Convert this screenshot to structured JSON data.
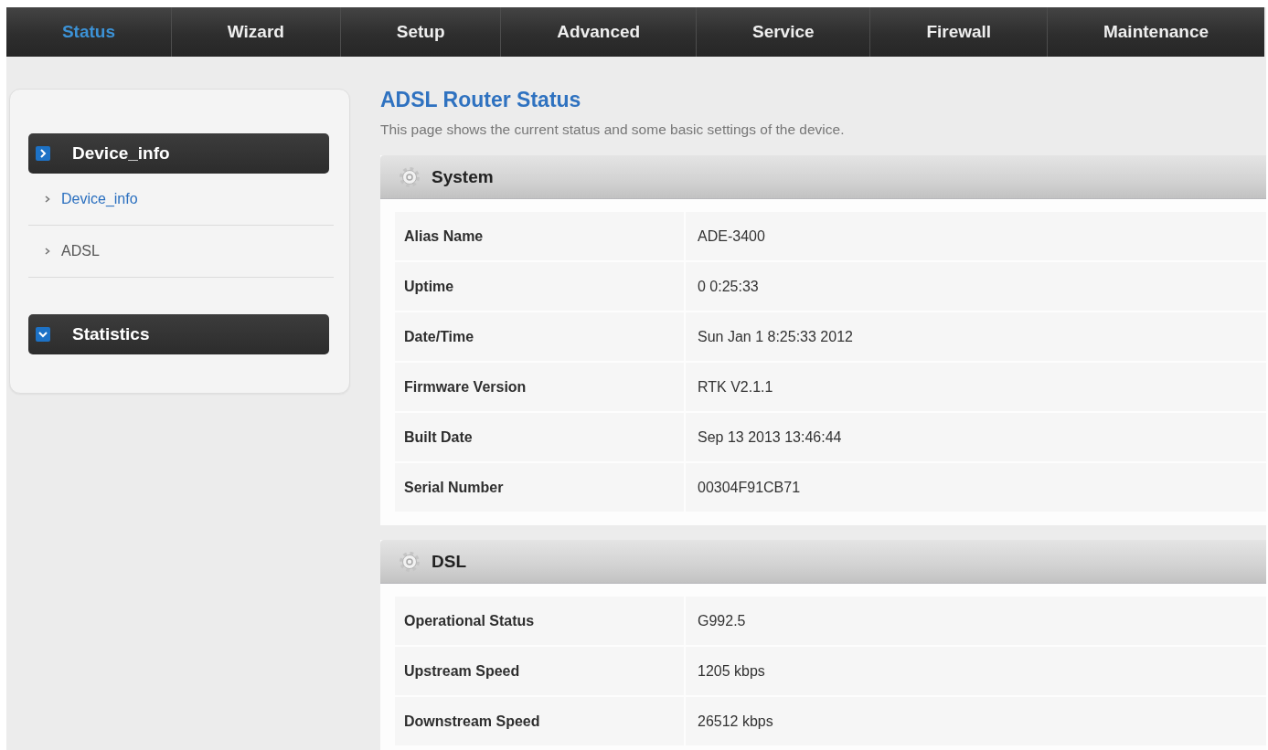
{
  "nav": [
    {
      "label": "Status",
      "selected": true
    },
    {
      "label": "Wizard",
      "selected": false
    },
    {
      "label": "Setup",
      "selected": false
    },
    {
      "label": "Advanced",
      "selected": false
    },
    {
      "label": "Service",
      "selected": false
    },
    {
      "label": "Firewall",
      "selected": false
    },
    {
      "label": "Maintenance",
      "selected": false
    }
  ],
  "sidebar": {
    "groups": [
      {
        "title": "Device_info",
        "expanded": true,
        "items": [
          {
            "label": "Device_info",
            "selected": true
          },
          {
            "label": "ADSL",
            "selected": false
          }
        ]
      },
      {
        "title": "Statistics",
        "expanded": false
      }
    ]
  },
  "page": {
    "title": "ADSL Router Status",
    "description": "This page shows the current status and some basic settings of the device."
  },
  "sections": [
    {
      "title": "System",
      "rows": [
        {
          "label": "Alias Name",
          "value": "ADE-3400"
        },
        {
          "label": "Uptime",
          "value": "0 0:25:33"
        },
        {
          "label": "Date/Time",
          "value": "Sun Jan 1 8:25:33 2012"
        },
        {
          "label": "Firmware Version",
          "value": "RTK V2.1.1"
        },
        {
          "label": "Built Date",
          "value": "Sep 13 2013 13:46:44"
        },
        {
          "label": "Serial Number",
          "value": "00304F91CB71"
        }
      ]
    },
    {
      "title": "DSL",
      "rows": [
        {
          "label": "Operational Status",
          "value": "G992.5"
        },
        {
          "label": "Upstream Speed",
          "value": "1205 kbps"
        },
        {
          "label": "Downstream Speed",
          "value": "26512 kbps"
        }
      ]
    }
  ]
}
